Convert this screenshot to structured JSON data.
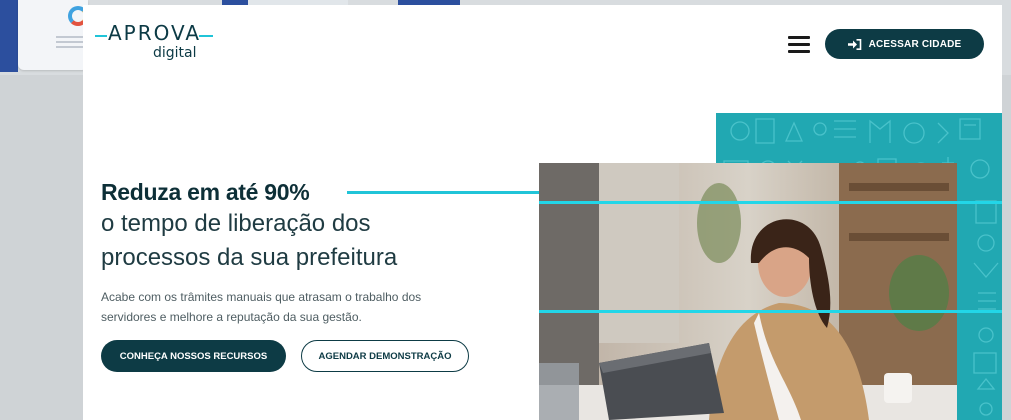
{
  "logo": {
    "top": "APROVA",
    "bottom": "digital"
  },
  "header": {
    "access_button": "ACESSAR CIDADE"
  },
  "hero": {
    "title_bold": "Reduza em até 90%",
    "title_line2": "o tempo de liberação dos",
    "title_line3": "processos da sua prefeitura",
    "desc_line1": "Acabe com os trâmites manuais que atrasam o trabalho dos",
    "desc_line2": "servidores e melhore a reputação da sua gestão.",
    "primary_button": "CONHEÇA NOSSOS RECURSOS",
    "secondary_button": "AGENDAR DEMONSTRAÇÃO"
  },
  "colors": {
    "brand_dark": "#0d3b45",
    "accent_cyan": "#20c4d8",
    "teal_panel": "#21a8b2"
  },
  "icons": {
    "menu": "hamburger-icon",
    "login": "login-icon"
  }
}
